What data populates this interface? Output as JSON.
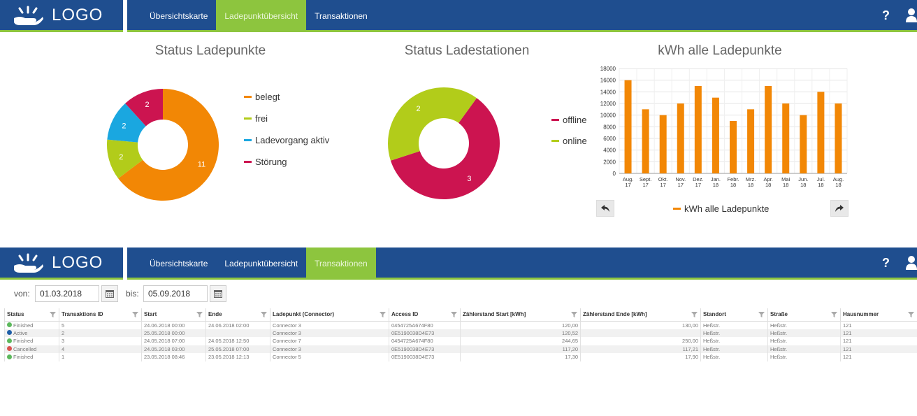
{
  "nav": {
    "logo_text": "LOGO",
    "tabs": [
      "Übersichtskarte",
      "Ladepunktübersicht",
      "Transaktionen"
    ],
    "help_label": "?",
    "active_top": 1,
    "active_bottom": 2,
    "colors": {
      "bar": "#1f4e8f",
      "active": "#8dc53e"
    }
  },
  "charts": {
    "ladepunkte": {
      "title": "Status Ladepunkte",
      "legend": [
        "belegt",
        "frei",
        "Ladevorgang aktiv",
        "Störung"
      ]
    },
    "ladestationen": {
      "title": "Status Ladestationen",
      "legend": [
        "offline",
        "online"
      ]
    },
    "kwh": {
      "title": "kWh alle Ladepunkte",
      "legend": "kWh alle Ladepunkte"
    }
  },
  "chart_data": [
    {
      "type": "pie",
      "title": "Status Ladepunkte",
      "categories": [
        "belegt",
        "frei",
        "Ladevorgang aktiv",
        "Störung"
      ],
      "values": [
        11,
        2,
        2,
        2
      ],
      "colors": [
        "#f28705",
        "#b2cc1a",
        "#1aa7e0",
        "#cc1450"
      ]
    },
    {
      "type": "pie",
      "title": "Status Ladestationen",
      "categories": [
        "offline",
        "online"
      ],
      "values": [
        3,
        2
      ],
      "colors": [
        "#cc1450",
        "#b2cc1a"
      ]
    },
    {
      "type": "bar",
      "title": "kWh alle Ladepunkte",
      "categories": [
        [
          "Aug.",
          "17"
        ],
        [
          "Sept.",
          "17"
        ],
        [
          "Okt.",
          "17"
        ],
        [
          "Nov.",
          "17"
        ],
        [
          "Dez.",
          "17"
        ],
        [
          "Jan.",
          "18"
        ],
        [
          "Febr.",
          "18"
        ],
        [
          "Mrz.",
          "18"
        ],
        [
          "Apr.",
          "18"
        ],
        [
          "Mai",
          "18"
        ],
        [
          "Jun.",
          "18"
        ],
        [
          "Jul.",
          "18"
        ],
        [
          "Aug.",
          "18"
        ]
      ],
      "series": [
        {
          "name": "kWh alle Ladepunkte",
          "values": [
            16000,
            11000,
            10000,
            12000,
            15000,
            13000,
            9000,
            11000,
            15000,
            12000,
            10000,
            14000,
            12000
          ]
        }
      ],
      "ylim": [
        0,
        18000
      ],
      "yticks": [
        0,
        2000,
        4000,
        6000,
        8000,
        10000,
        12000,
        14000,
        16000,
        18000
      ],
      "grid": true,
      "color": "#f28705"
    }
  ],
  "filter": {
    "from_label": "von:",
    "from_value": "01.03.2018",
    "to_label": "bis:",
    "to_value": "05.09.2018"
  },
  "table": {
    "columns": [
      "Status",
      "Transaktions ID",
      "Start",
      "Ende",
      "Ladepunkt (Connector)",
      "Access ID",
      "Zählerstand Start [kWh]",
      "Zählerstand Ende [kWh]",
      "Standort",
      "Straße",
      "Hausnummer"
    ],
    "rows": [
      [
        "Finished",
        "5",
        "24.06.2018 00:00",
        "24.06.2018 02:00",
        "Connector 3",
        "0454725A674F80",
        "120,00",
        "130,00",
        "Heßstr.",
        "Heßstr.",
        "121"
      ],
      [
        "Active",
        "2",
        "25.05.2018 00:00",
        "",
        "Connector 3",
        "0E5190038D4E73",
        "120,52",
        "",
        "Heßstr.",
        "Heßstr.",
        "121"
      ],
      [
        "Finished",
        "3",
        "24.05.2018 07:00",
        "24.05.2018 12:50",
        "Connector 7",
        "0454725A674F80",
        "244,65",
        "250,00",
        "Heßstr.",
        "Heßstr.",
        "121"
      ],
      [
        "Cancelled",
        "4",
        "24.05.2018 03:00",
        "25.05.2018 07:00",
        "Connector 3",
        "0E5190038D4E73",
        "117,20",
        "117,21",
        "Heßstr.",
        "Heßstr.",
        "121"
      ],
      [
        "Finished",
        "1",
        "23.05.2018 08:46",
        "23.05.2018 12:13",
        "Connector 5",
        "0E5190038D4E73",
        "17,30",
        "17,90",
        "Heßstr.",
        "Heßstr.",
        "121"
      ]
    ],
    "status_colors": {
      "Finished": "#5cb85c",
      "Active": "#1f5fa8",
      "Cancelled": "#d9534f"
    }
  }
}
